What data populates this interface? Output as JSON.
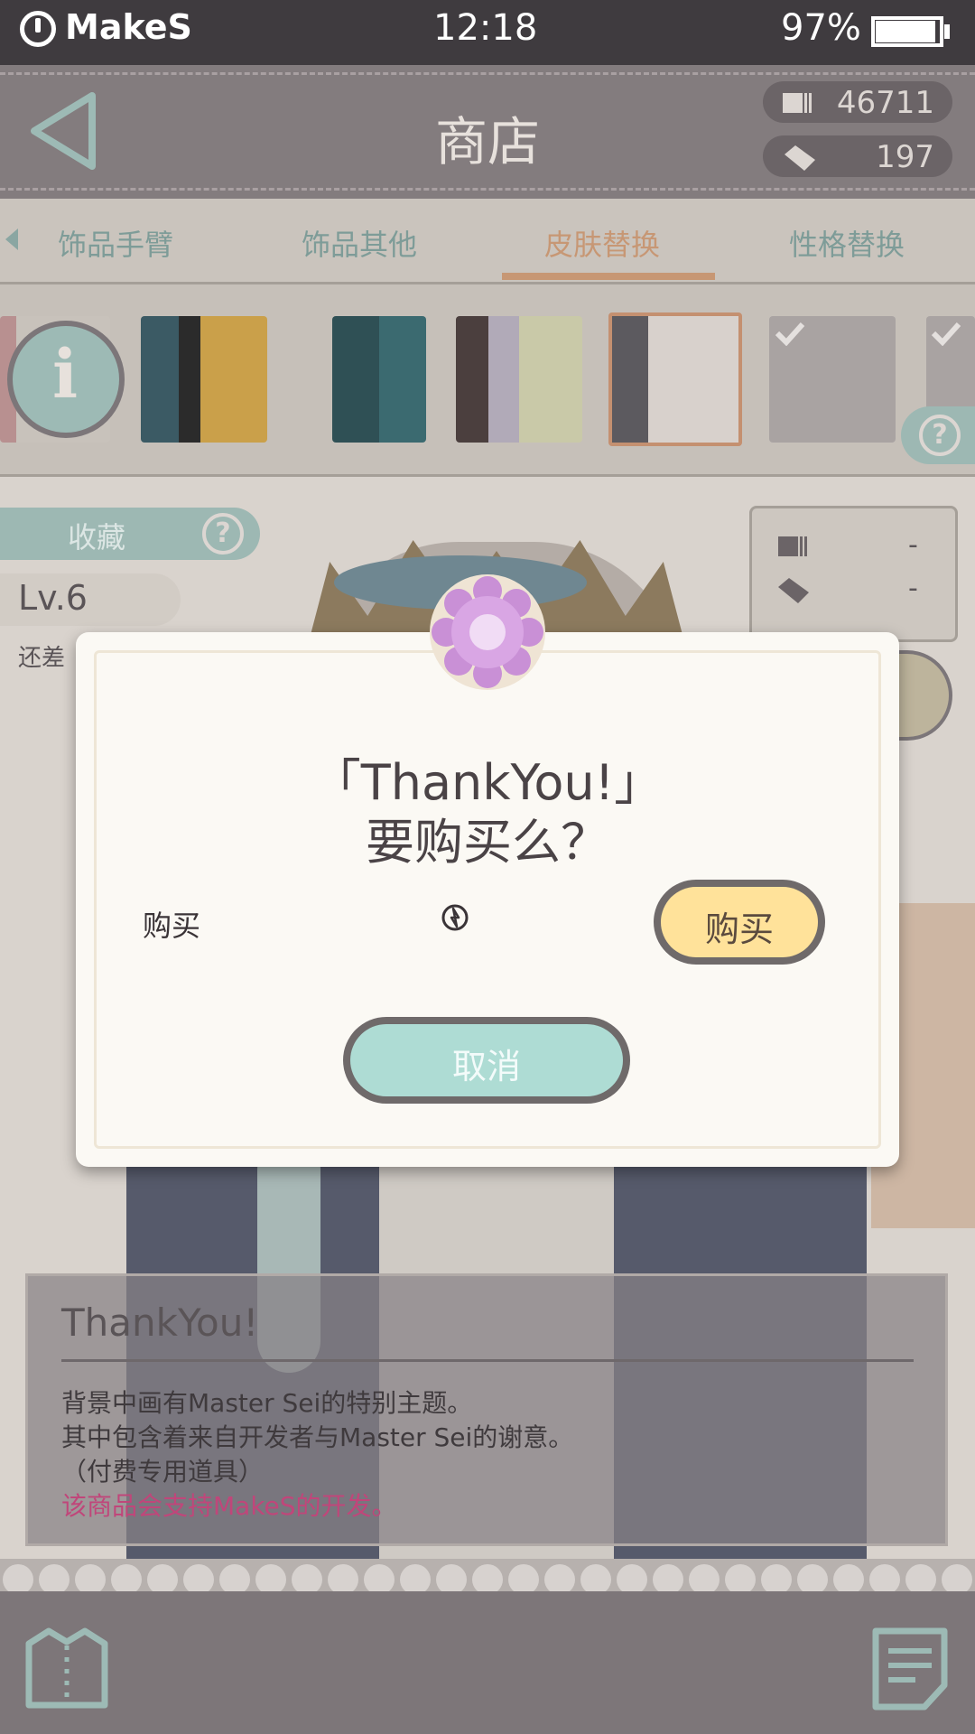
{
  "status_bar": {
    "brand": "MakeS",
    "time": "12:18",
    "battery": "97%"
  },
  "header": {
    "title": "商店",
    "currency_cards": "46711",
    "currency_tickets": "197"
  },
  "tabs": [
    {
      "label": "饰品手臂"
    },
    {
      "label": "饰品其他"
    },
    {
      "label": "皮肤替换",
      "active": true
    },
    {
      "label": "性格替换"
    }
  ],
  "side": {
    "favorite_label": "收藏",
    "level": "Lv.6",
    "remaining_label": "还差",
    "price_card": "-",
    "price_ticket": "-"
  },
  "description": {
    "title": "ThankYou!",
    "line1": "背景中画有Master Sei的特别主题。",
    "line2": "其中包含着来自开发者与Master Sei的谢意。",
    "line3": "（付费专用道具）",
    "line4": "该商品会支持MakeS的开发。"
  },
  "dialog": {
    "title_line1": "「ThankYou!」",
    "title_line2": "要购买么？",
    "buy_row_label": "购买",
    "buy_button": "购买",
    "cancel_button": "取消"
  },
  "colors": {
    "accent_tab": "#c79774",
    "teal_button": "#aedcd4",
    "yellow_button": "#ffe29a",
    "purchase_note": "#c0467a"
  }
}
